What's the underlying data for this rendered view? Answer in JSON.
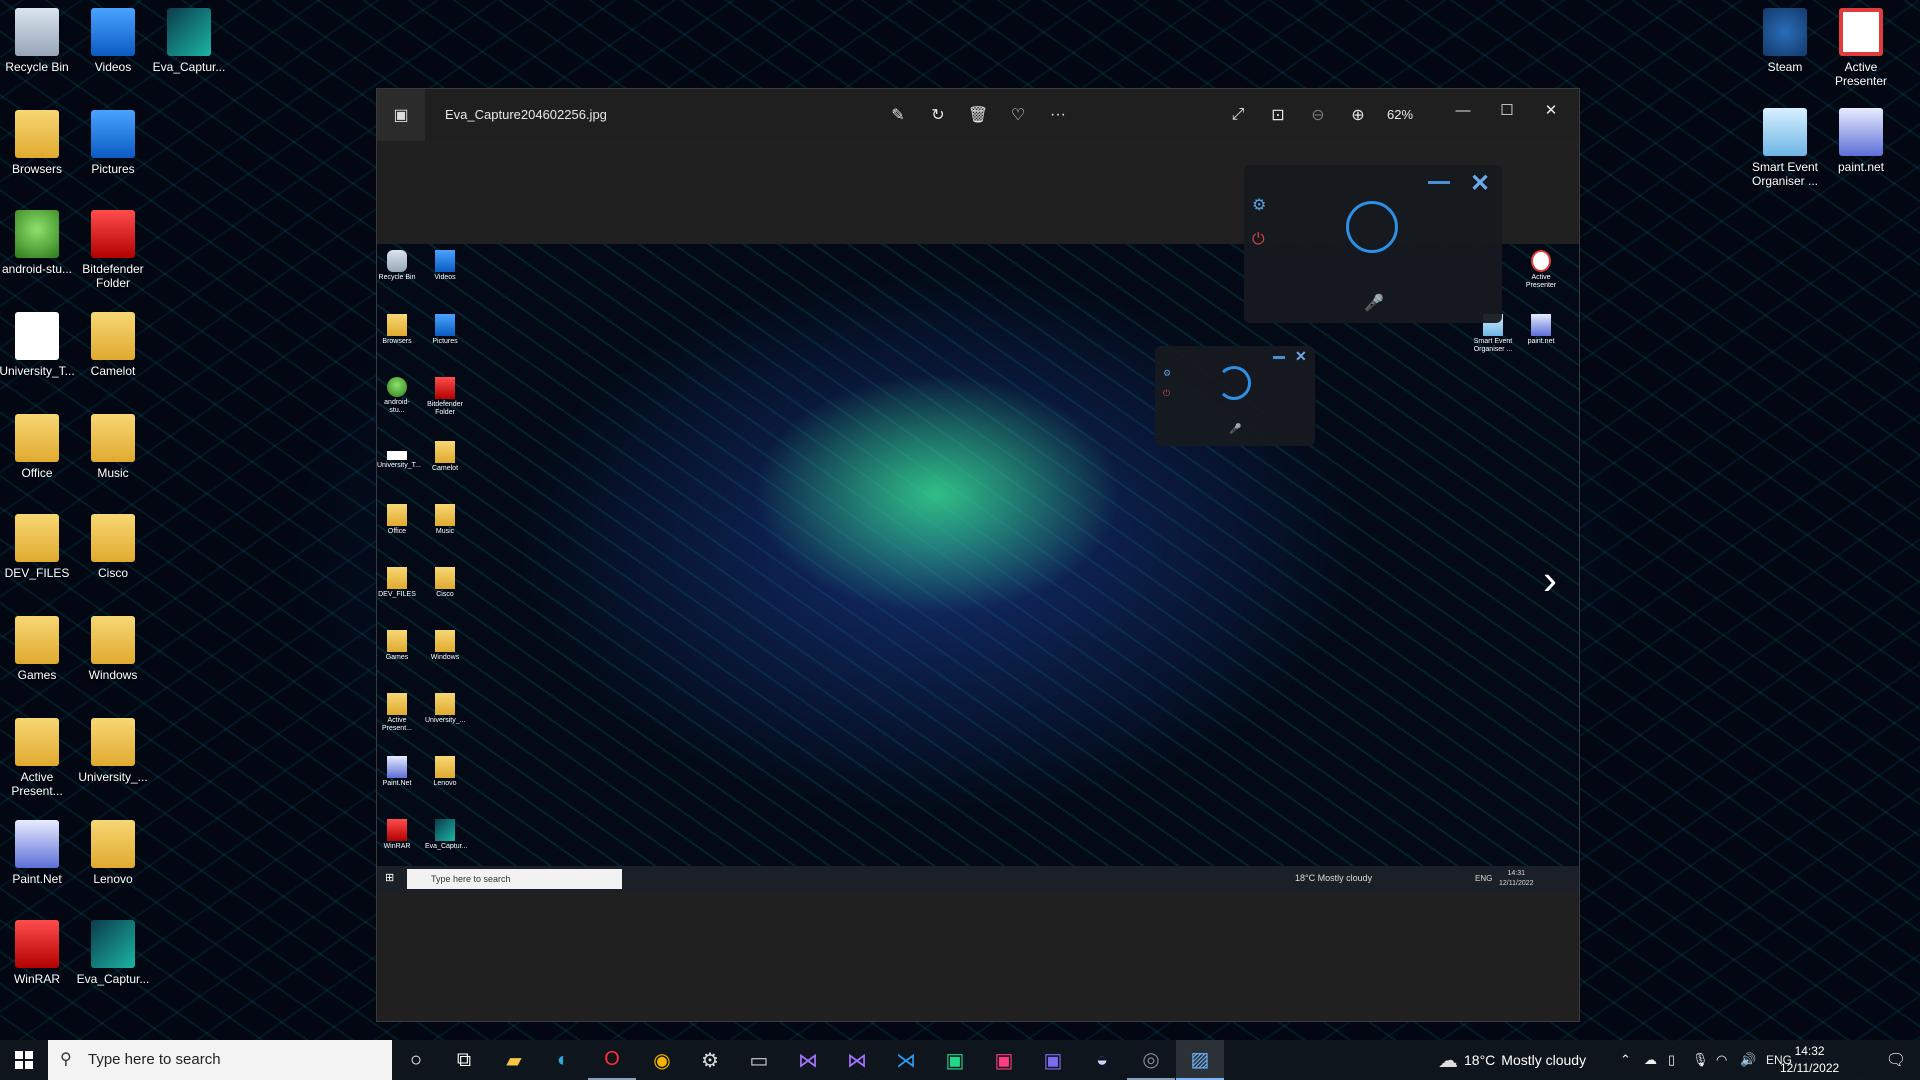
{
  "desktop": {
    "left_icons": [
      {
        "label": "Recycle Bin",
        "icon": "recycle-bin-icon"
      },
      {
        "label": "Videos",
        "icon": "videos-folder-icon"
      },
      {
        "label": "Eva_Captur...",
        "icon": "image-file-icon"
      },
      {
        "label": "Browsers",
        "icon": "folder-icon"
      },
      {
        "label": "Pictures",
        "icon": "pictures-folder-icon"
      },
      {
        "label": "android-stu...",
        "icon": "android-studio-icon"
      },
      {
        "label": "Bitdefender Folder",
        "icon": "bitdefender-icon"
      },
      {
        "label": "University_T...",
        "icon": "file-icon"
      },
      {
        "label": "Camelot",
        "icon": "folder-icon"
      },
      {
        "label": "Office",
        "icon": "folder-icon"
      },
      {
        "label": "Music",
        "icon": "music-folder-icon"
      },
      {
        "label": "DEV_FILES",
        "icon": "folder-icon"
      },
      {
        "label": "Cisco",
        "icon": "folder-icon"
      },
      {
        "label": "Games",
        "icon": "folder-icon"
      },
      {
        "label": "Windows",
        "icon": "folder-icon"
      },
      {
        "label": "Active Present...",
        "icon": "active-presenter-file-icon"
      },
      {
        "label": "University_...",
        "icon": "folder-icon"
      },
      {
        "label": "Paint.Net",
        "icon": "paint-net-icon"
      },
      {
        "label": "Lenovo",
        "icon": "lenovo-folder-icon"
      },
      {
        "label": "WinRAR",
        "icon": "winrar-icon"
      },
      {
        "label": "Eva_Captur...",
        "icon": "image-file-icon"
      }
    ],
    "right_icons": [
      {
        "label": "Steam",
        "icon": "steam-icon"
      },
      {
        "label": "Active Presenter",
        "icon": "active-presenter-icon"
      },
      {
        "label": "Smart Event Organiser ...",
        "icon": "clock-icon"
      },
      {
        "label": "paint.net",
        "icon": "paint-net-icon"
      }
    ]
  },
  "viewer": {
    "filename": "Eva_Capture204602256.jpg",
    "zoom": "62%",
    "toolbar": [
      "edit-icon",
      "rotate-icon",
      "delete-icon",
      "favorite-icon",
      "more-icon"
    ],
    "more_label": "···",
    "inner_screenshot": {
      "icons": [
        "Recycle Bin",
        "Videos",
        "Browsers",
        "Pictures",
        "android-stu...",
        "Bitdefender Folder",
        "University_T...",
        "Camelot",
        "Office",
        "Music",
        "DEV_FILES",
        "Cisco",
        "Games",
        "Windows",
        "Active Present...",
        "University_...",
        "Paint.Net",
        "Lenovo",
        "WinRAR",
        "Eva_Captur..."
      ],
      "right_icons": [
        "Active Presenter",
        "Smart Event Organiser ...",
        "paint.net"
      ],
      "search_placeholder": "Type here to search",
      "weather": "18°C  Mostly cloudy",
      "lang": "ENG",
      "time": "14:31",
      "date": "12/11/2022"
    }
  },
  "taskbar": {
    "search_placeholder": "Type here to search",
    "weather_temp": "18°C",
    "weather_desc": "Mostly cloudy",
    "lang": "ENG",
    "time": "14:32",
    "date": "12/11/2022"
  }
}
